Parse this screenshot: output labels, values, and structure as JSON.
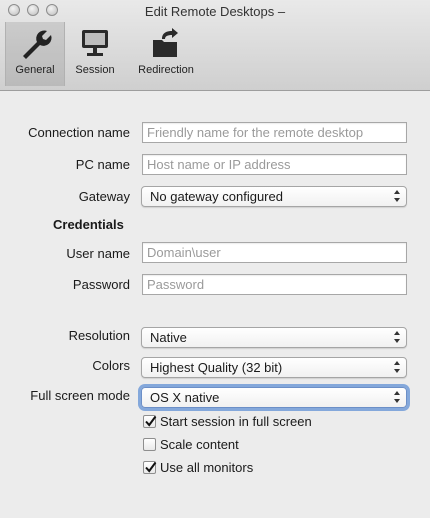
{
  "window": {
    "title": "Edit Remote Desktops –"
  },
  "toolbar": {
    "items": [
      {
        "label": "General",
        "icon": "wrench-icon",
        "selected": true
      },
      {
        "label": "Session",
        "icon": "monitor-icon",
        "selected": false
      },
      {
        "label": "Redirection",
        "icon": "folder-redirect-icon",
        "selected": false
      }
    ]
  },
  "form": {
    "connection_name": {
      "label": "Connection name",
      "placeholder": "Friendly name for the remote desktop",
      "value": ""
    },
    "pc_name": {
      "label": "PC name",
      "placeholder": "Host name or IP address",
      "value": ""
    },
    "gateway": {
      "label": "Gateway",
      "value": "No gateway configured"
    },
    "credentials_heading": "Credentials",
    "user_name": {
      "label": "User name",
      "placeholder": "Domain\\user",
      "value": ""
    },
    "password": {
      "label": "Password",
      "placeholder": "Password",
      "value": ""
    },
    "resolution": {
      "label": "Resolution",
      "value": "Native"
    },
    "colors": {
      "label": "Colors",
      "value": "Highest Quality (32 bit)"
    },
    "full_screen_mode": {
      "label": "Full screen mode",
      "value": "OS X native"
    },
    "start_fullscreen": {
      "label": "Start session in full screen",
      "checked": true
    },
    "scale_content": {
      "label": "Scale content",
      "checked": false
    },
    "use_all_monitors": {
      "label": "Use all monitors",
      "checked": true
    }
  }
}
